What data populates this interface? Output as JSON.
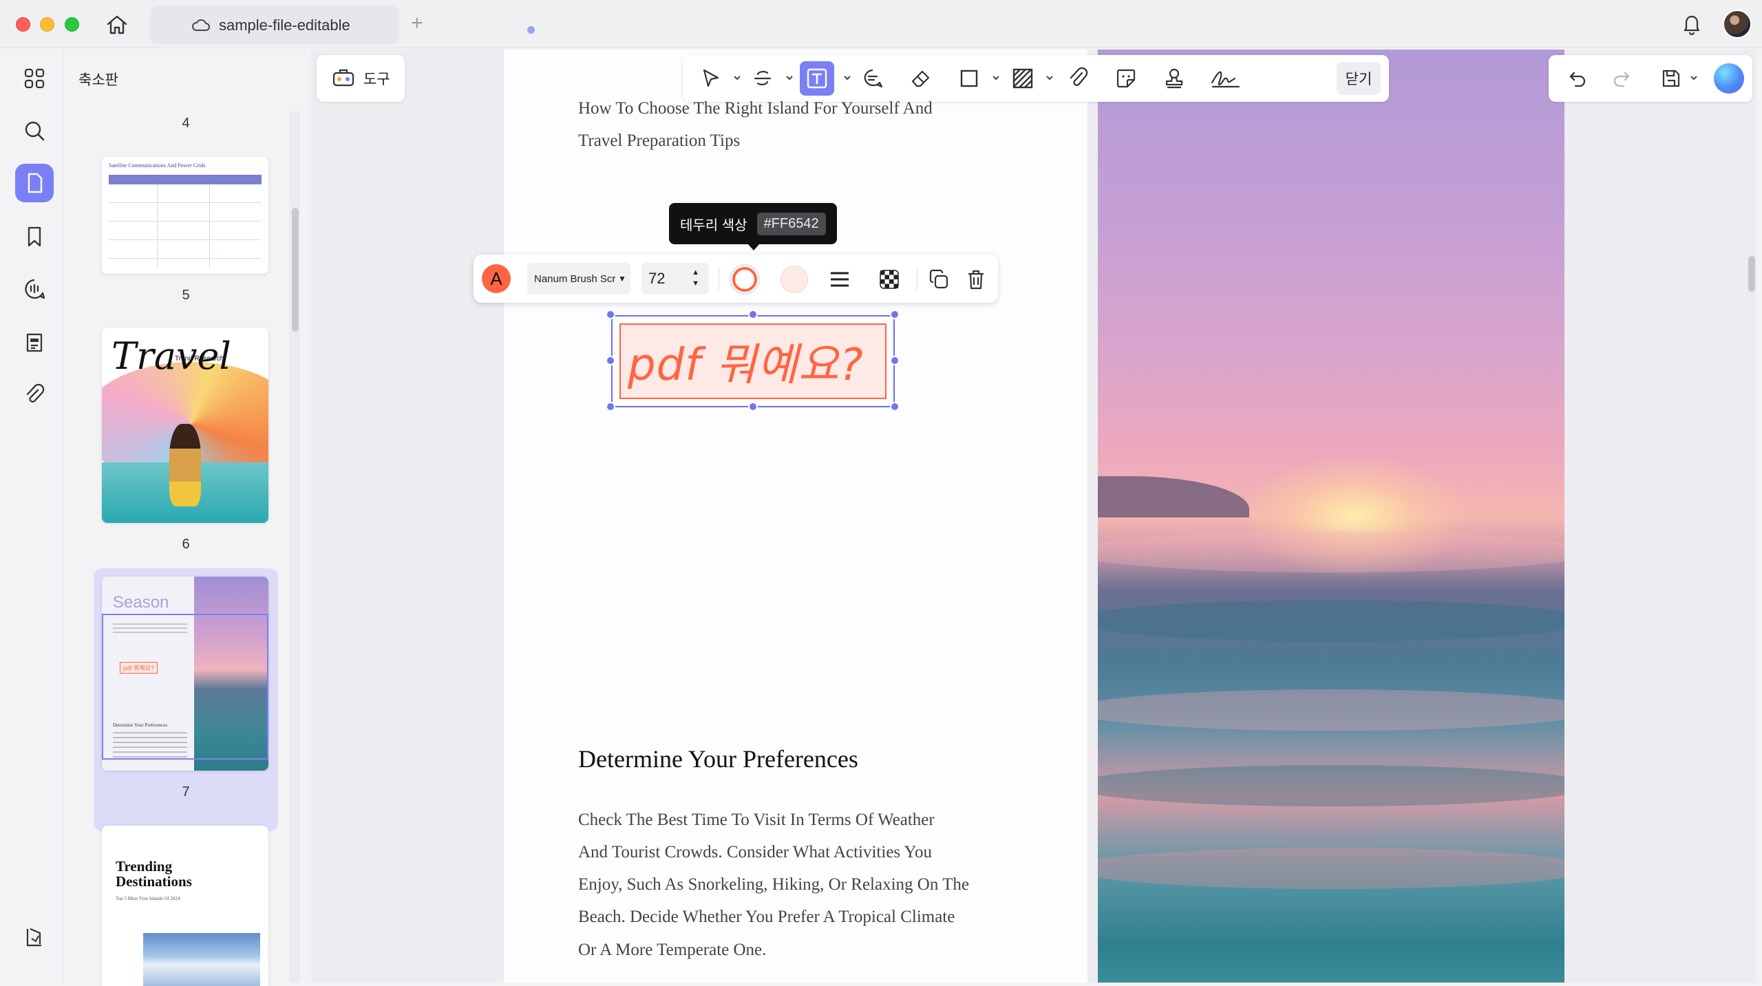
{
  "titlebar": {
    "tab_title": "sample-file-editable"
  },
  "sidebar": {
    "title": "축소판",
    "page_numbers": [
      "4",
      "5",
      "6",
      "7"
    ],
    "thumb5": {
      "title": "Satellite Communications And Power Grids"
    },
    "thumb6": {
      "script_title": "Travel",
      "subtitle": "Trend Research"
    },
    "thumb7": {
      "title": "Season",
      "text_box": "pdf 뭐예요?",
      "heading": "Determine Your Preferences"
    },
    "thumb8": {
      "title": "Trending Destinations",
      "subtitle": "Top 5 Must Visit Islands Of 2024"
    }
  },
  "toolbar": {
    "tools_label": "도구",
    "close_label": "닫기"
  },
  "document": {
    "intro_line1": "How To Choose The Right Island For Yourself And",
    "intro_line2": "Travel Preparation Tips",
    "heading": "Determine Your Preferences",
    "body_lines": [
      "Check The Best Time To Visit In Terms Of Weather",
      "And Tourist Crowds. Consider What Activities You",
      "Enjoy, Such As Snorkeling, Hiking, Or Relaxing On The",
      "Beach. Decide Whether You Prefer A Tropical Climate",
      "Or A More Temperate One."
    ]
  },
  "tooltip": {
    "label": "테두리 색상",
    "value": "#FF6542"
  },
  "text_props": {
    "font_name": "Nanum Brush Script",
    "font_size": "72",
    "text_color": "#FF6542",
    "border_color": "#FF6542",
    "fill_color": "#FDE9E5"
  },
  "text_box": {
    "content": "pdf 뭐예요?"
  },
  "colors": {
    "accent": "#7B7FF5",
    "selection": "#6B6FF0"
  }
}
